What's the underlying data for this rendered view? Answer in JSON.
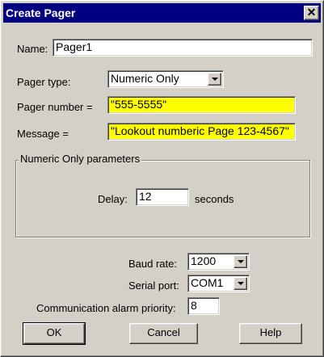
{
  "window": {
    "title": "Create Pager",
    "close_glyph": "✕"
  },
  "form": {
    "name_label": "Name:",
    "name_value": "Pager1",
    "pager_type_label": "Pager type:",
    "pager_type_value": "Numeric Only",
    "pager_number_label": "Pager number =",
    "pager_number_value": "\"555-5555\"",
    "message_label": "Message =",
    "message_value": "\"Lookout numberic Page 123-4567\""
  },
  "params": {
    "group_title": "Numeric Only parameters",
    "delay_label": "Delay:",
    "delay_value": "12",
    "delay_unit": "seconds"
  },
  "comm": {
    "baud_label": "Baud rate:",
    "baud_value": "1200",
    "serial_label": "Serial port:",
    "serial_value": "COM1",
    "priority_label": "Communication alarm priority:",
    "priority_value": "8"
  },
  "buttons": {
    "ok": "OK",
    "cancel": "Cancel",
    "help": "Help"
  },
  "colors": {
    "titlebar": "#000080",
    "dialog": "#d4d0c8",
    "highlight_field": "#ffff00"
  }
}
